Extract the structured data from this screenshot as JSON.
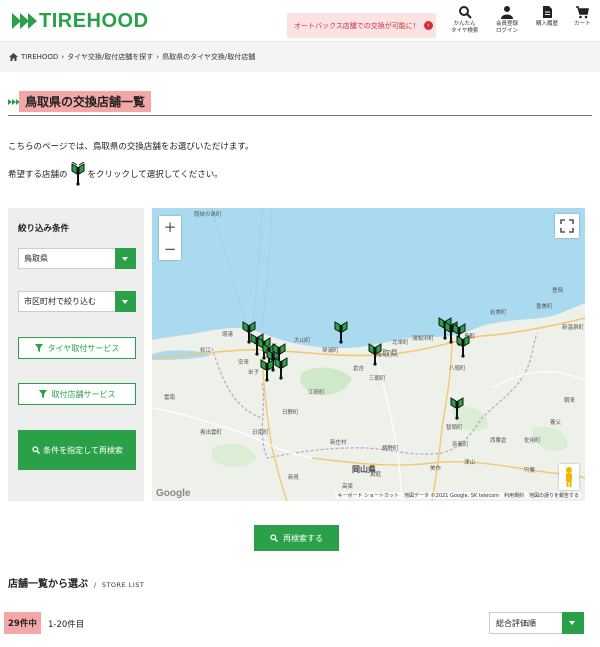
{
  "header": {
    "logo": "TIREHOOD",
    "promo": "オートバックス店舗での交換が可能に！",
    "nav": [
      {
        "label": "かんたん\nタイヤ検索",
        "icon": "search-icon"
      },
      {
        "label": "会員登録\nログイン",
        "icon": "user-icon"
      },
      {
        "label": "購入履歴",
        "icon": "document-icon"
      },
      {
        "label": "カート",
        "icon": "cart-icon"
      }
    ]
  },
  "breadcrumb": {
    "home": "TIREHOOD",
    "items": [
      "タイヤ交換/取付店舗を探す",
      "鳥取県のタイヤ交換/取付店舗"
    ]
  },
  "page": {
    "title": "鳥取県の交換店舗一覧",
    "intro1": "こちらのページでは、鳥取県の交換店舗をお選びいただけます。",
    "intro2_before": "希望する店舗の",
    "intro2_after": "をクリックして選択してください。"
  },
  "sidebar": {
    "title": "絞り込み条件",
    "prefecture": "鳥取県",
    "city": "市区町村で絞り込む",
    "filter1": "タイヤ取付サービス",
    "filter2": "取付店舗サービス",
    "search": "条件を指定して再検索"
  },
  "map": {
    "zoom_in": "+",
    "zoom_out": "−",
    "attribution": "キーボード ショートカット　地図データ ©2021 Google, SK telecom　利用規約　地図の誤りを報告する",
    "google": "Google",
    "region_label": "鳥取県",
    "prefecture_label": "岡山県",
    "labels": [
      "松江",
      "安来",
      "大山町",
      "琴浦町",
      "倉吉",
      "三朝町",
      "鳥取",
      "八頭町",
      "岩美町",
      "香美町",
      "新温泉町",
      "日野町",
      "日南町",
      "新見",
      "真庭",
      "美作",
      "津山",
      "奈義町",
      "智頭町",
      "鏡野町",
      "西粟倉",
      "佐用町",
      "宍粟",
      "新庄村",
      "雲南",
      "奥出雲町",
      "朝来",
      "養父",
      "境港",
      "米子",
      "湯梨浜町",
      "北栄町",
      "江府町",
      "高梁",
      "豊岡",
      "隠岐の島町"
    ]
  },
  "research_button": "再検索する",
  "list": {
    "title": "店舗一覧から選ぶ",
    "subtitle": "STORE LIST",
    "count": "29件中",
    "range": "1-20件目",
    "sort": "総合評価順"
  },
  "colors": {
    "brand": "#2aa148",
    "highlight": "#f3a7a7",
    "promo": "#d0303a"
  }
}
